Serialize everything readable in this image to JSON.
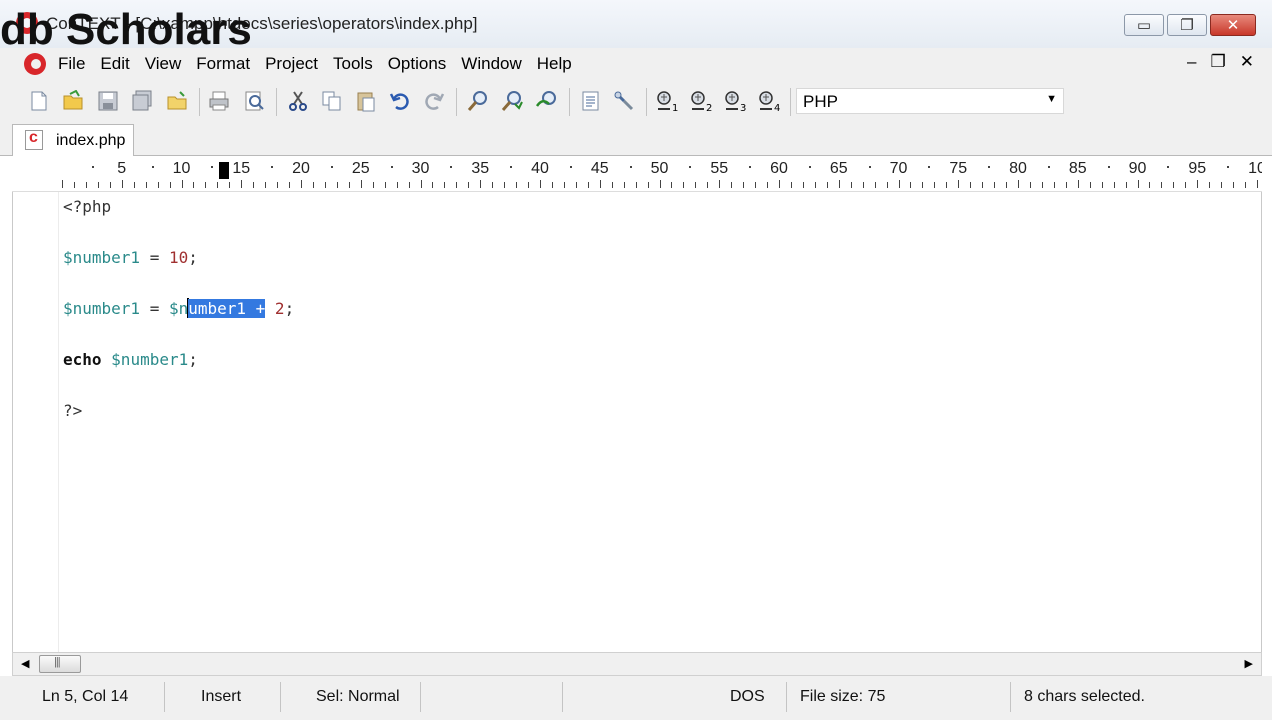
{
  "window": {
    "title": "ConTEXT - [C:\\xampp\\htdocs\\series\\operators\\index.php]",
    "watermark": "db Scholars",
    "controls": {
      "minimize": "▭",
      "maximize": "❐",
      "close": "✕"
    }
  },
  "menubar": {
    "items": [
      "File",
      "Edit",
      "View",
      "Format",
      "Project",
      "Tools",
      "Options",
      "Window",
      "Help"
    ],
    "mdi_controls": {
      "minimize": "–",
      "restore": "❐",
      "close": "✕"
    }
  },
  "toolbar": {
    "icons": [
      "new-file-icon",
      "open-file-icon",
      "save-icon",
      "save-all-icon",
      "open-folder-icon",
      "print-icon",
      "print-preview-icon",
      "cut-icon",
      "copy-icon",
      "paste-icon",
      "undo-icon",
      "redo-icon",
      "find-icon",
      "find-next-icon",
      "replace-icon",
      "document-properties-icon",
      "tools-icon",
      "user-command-1-icon",
      "user-command-2-icon",
      "user-command-3-icon",
      "user-command-4-icon"
    ],
    "language": "PHP"
  },
  "tabs": [
    {
      "label": "index.php",
      "active": true
    }
  ],
  "ruler": {
    "labels": [
      "5",
      "10",
      "15",
      "20",
      "25",
      "30",
      "35",
      "40",
      "45",
      "50",
      "55",
      "60",
      "65",
      "70",
      "75",
      "80",
      "85",
      "90",
      "95",
      "10"
    ]
  },
  "editor": {
    "lines": {
      "l1": {
        "open": "<?php"
      },
      "l3": {
        "var": "$number1",
        "assign": " = ",
        "num": "10",
        "end": ";"
      },
      "l5": {
        "var": "$number1",
        "assign": " = ",
        "pre": "$n",
        "sel": "umber1 +",
        "rest": " 2",
        "end": ";"
      },
      "l7": {
        "kw": "echo",
        "sp": " ",
        "var": "$number1",
        "end": ";"
      },
      "l9": {
        "close": "?>"
      }
    },
    "colors": {
      "variable": "#2a8a8a",
      "number": "#a03030",
      "selection": "#3479e0"
    }
  },
  "status": {
    "position": "Ln 5, Col 14",
    "mode": "Insert",
    "selection_mode": "Sel: Normal",
    "line_endings": "DOS",
    "file_size": "File size: 75",
    "selection_info": "8 chars selected."
  }
}
